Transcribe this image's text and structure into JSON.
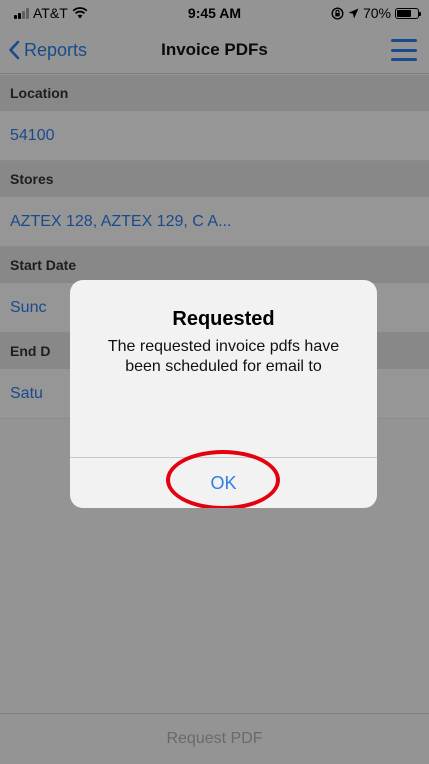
{
  "status_bar": {
    "carrier": "AT&T",
    "time": "9:45 AM",
    "battery": "70%",
    "battery_level": 0.7
  },
  "nav": {
    "back_label": "Reports",
    "title": "Invoice PDFs"
  },
  "form": {
    "location_label": "Location",
    "location_value": "54100",
    "stores_label": "Stores",
    "stores_value": "AZTEX 128, AZTEX 129, C A...",
    "start_date_label": "Start Date",
    "start_date_value": "Sunc",
    "end_date_label": "End D",
    "end_date_value": "Satu"
  },
  "bottom": {
    "request_label": "Request PDF"
  },
  "alert": {
    "title": "Requested",
    "message": "The requested invoice pdfs have been scheduled for email to",
    "ok_label": "OK"
  },
  "colors": {
    "accent": "#2b7de9",
    "annotation": "#e4000f"
  }
}
